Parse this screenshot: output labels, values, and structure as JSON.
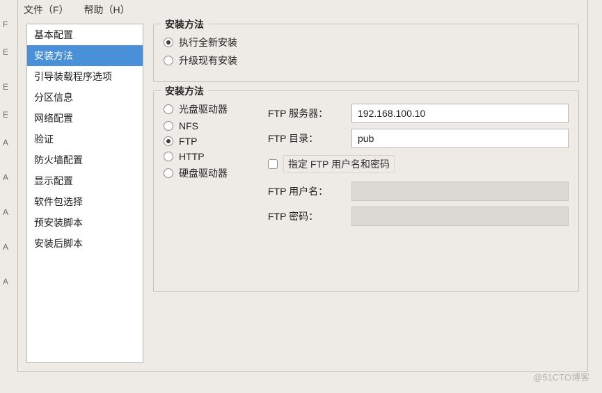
{
  "menu": {
    "file": "文件（F）",
    "help": "帮助（H）"
  },
  "left_rail": [
    "F",
    "E",
    "E",
    "E",
    "A",
    "A",
    "A",
    "A",
    "A"
  ],
  "sidebar": {
    "items": [
      {
        "label": "基本配置"
      },
      {
        "label": "安装方法"
      },
      {
        "label": "引导装载程序选项"
      },
      {
        "label": "分区信息"
      },
      {
        "label": "网络配置"
      },
      {
        "label": "验证"
      },
      {
        "label": "防火墙配置"
      },
      {
        "label": "显示配置"
      },
      {
        "label": "软件包选择"
      },
      {
        "label": "预安装脚本"
      },
      {
        "label": "安装后脚本"
      }
    ],
    "selected_index": 1
  },
  "group1": {
    "title": "安装方法",
    "opt_fresh": "执行全新安装",
    "opt_upgrade": "升级现有安装"
  },
  "group2": {
    "title": "安装方法",
    "src_cdrom": "光盘驱动器",
    "src_nfs": "NFS",
    "src_ftp": "FTP",
    "src_http": "HTTP",
    "src_hd": "硬盘驱动器",
    "ftp_server_label": "FTP 服务器：",
    "ftp_server_value": "192.168.100.10",
    "ftp_dir_label": "FTP 目录：",
    "ftp_dir_value": "pub",
    "ftp_auth_label": "指定 FTP 用户名和密码",
    "ftp_user_label": "FTP 用户名：",
    "ftp_user_value": "",
    "ftp_pass_label": "FTP 密码：",
    "ftp_pass_value": ""
  },
  "watermark": "@51CTO博客"
}
